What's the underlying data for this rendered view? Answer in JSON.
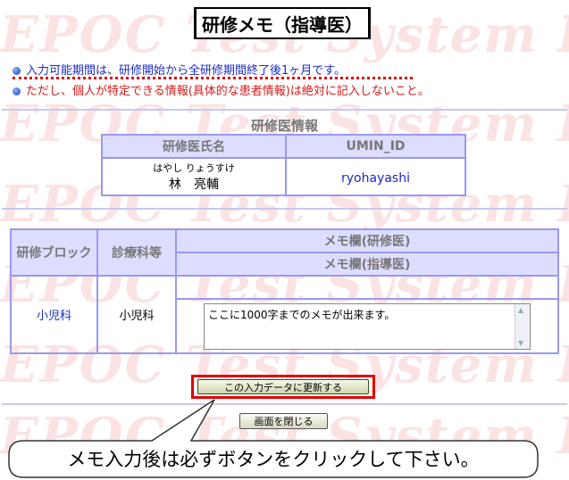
{
  "watermark": "EPOC Test System EPOC",
  "title": "研修メモ（指導医）",
  "notices": [
    "入力可能期間は、研修開始から全研修期間終了後1ヶ月です。",
    "ただし、個人が特定できる情報(具体的な患者情報)は絶対に記入しないこと。"
  ],
  "trainee_info": {
    "section_title": "研修医情報",
    "col_name": "研修医氏名",
    "col_umin": "UMIN_ID",
    "name_kana": "はやし りょうすけ",
    "name": "林　亮輔",
    "umin_id": "ryohayashi"
  },
  "memo_table": {
    "col_block": "研修ブロック",
    "col_dept": "診療科等",
    "col_memo_resident": "メモ欄(研修医)",
    "col_memo_supervisor": "メモ欄(指導医)",
    "block": "小児科",
    "dept": "小児科",
    "memo_text": "ここに1000字までのメモが出来ます。"
  },
  "buttons": {
    "update": "この入力データに更新する",
    "close": "画面を閉じる"
  },
  "callout": "メモ入力後は必ずボタンをクリックして下さい。"
}
